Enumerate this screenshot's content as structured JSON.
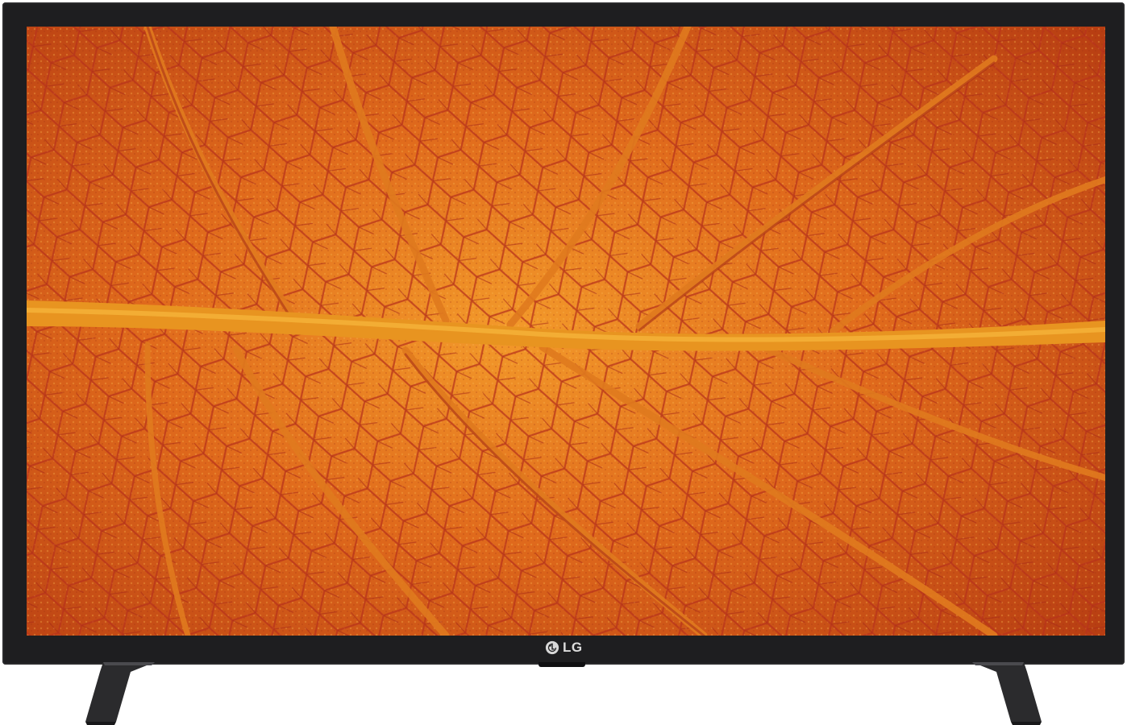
{
  "product": {
    "brand_text": "LG"
  },
  "colors": {
    "bezel": "#1e1e20",
    "leaf_base": "#d2551a",
    "leaf_highlight": "#f08a22",
    "vein": "#b0301c",
    "midrib": "#e8951e",
    "stand": "#2b2b2d"
  },
  "icons": {
    "logo": "lg-logo-icon"
  }
}
